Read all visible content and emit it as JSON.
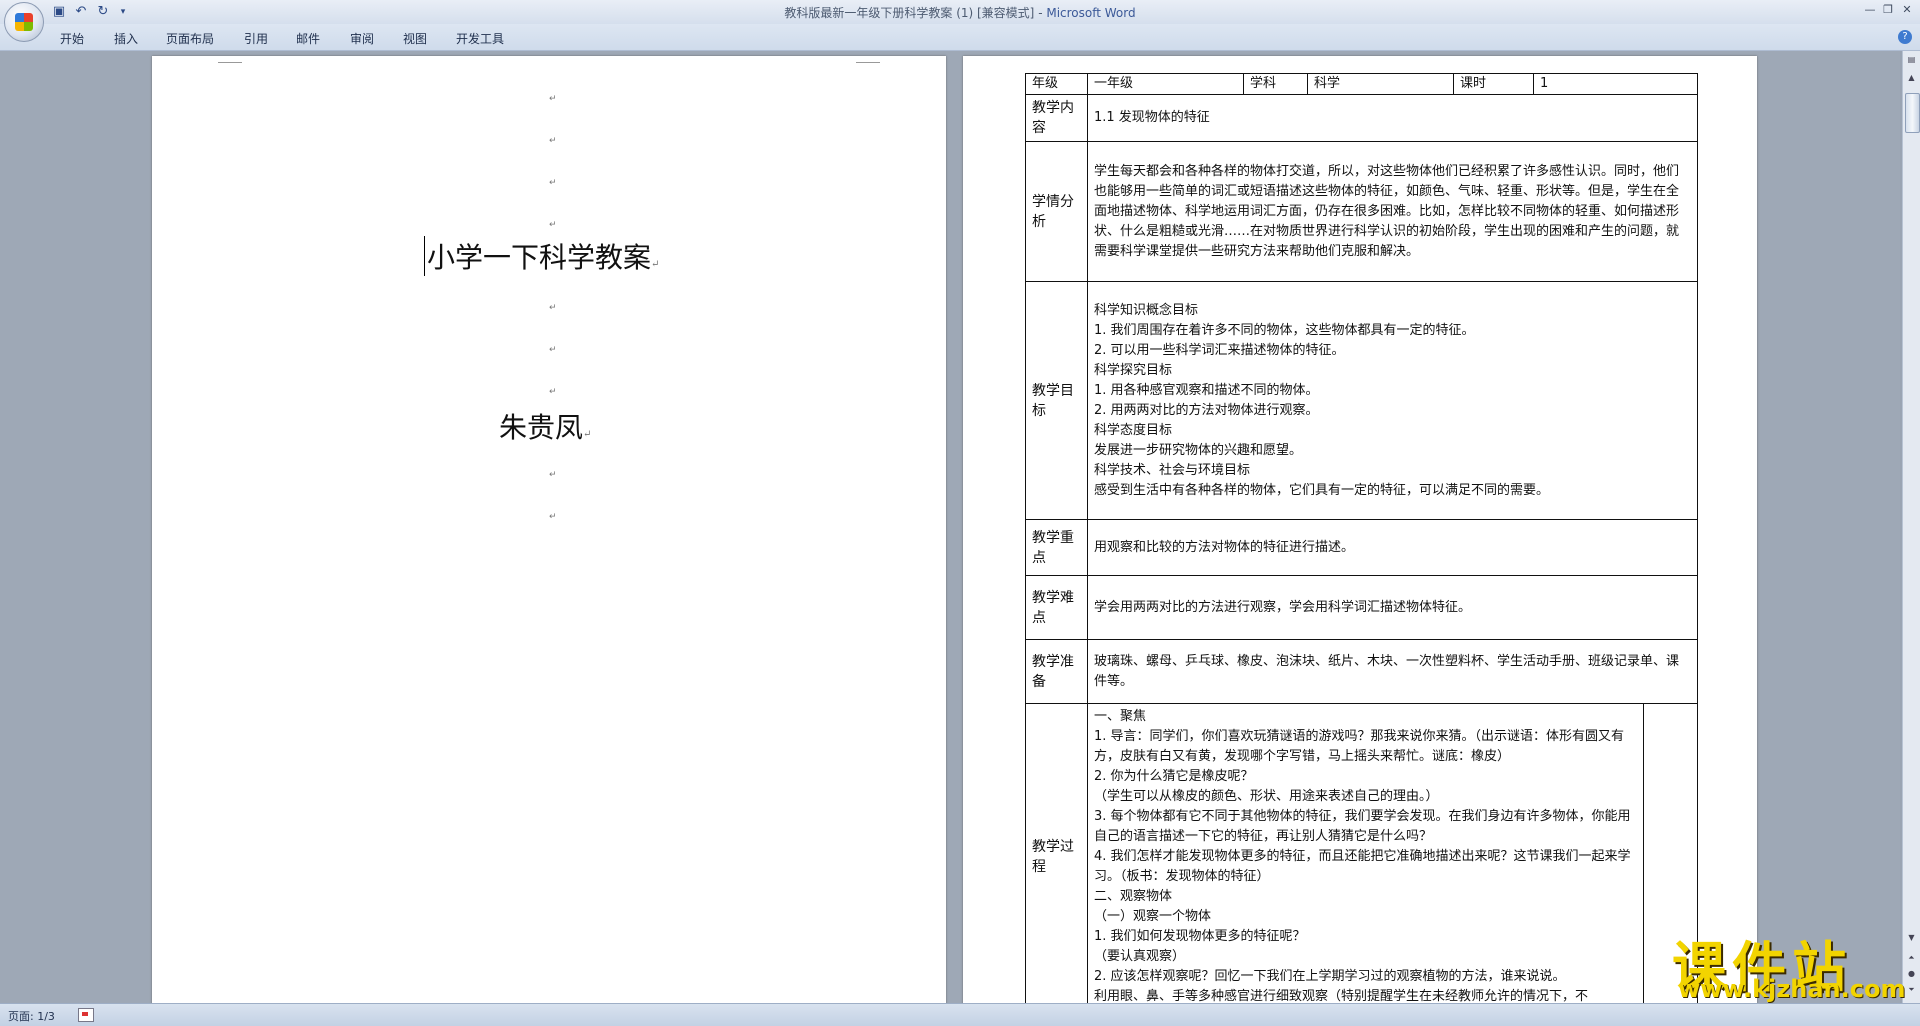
{
  "window": {
    "title": "教科版最新一年级下册科学教案 (1) [兼容模式]",
    "app_name": "Microsoft Word",
    "title_separator": " - "
  },
  "quick_access": {
    "save_icon": "save-icon",
    "undo_icon": "undo-icon",
    "redo_icon": "redo-icon",
    "customize_icon": "dropdown-icon"
  },
  "ribbon": {
    "tabs": [
      "开始",
      "插入",
      "页面布局",
      "引用",
      "邮件",
      "审阅",
      "视图",
      "开发工具"
    ]
  },
  "page1": {
    "title": "小学一下科学教案",
    "author": "朱贵凤",
    "para_mark": "↵"
  },
  "lesson": {
    "header": {
      "grade_label": "年级",
      "grade_value": "一年级",
      "subject_label": "学科",
      "subject_value": "科学",
      "period_label": "课时",
      "period_value": "1"
    },
    "rows": [
      {
        "label": "教学内容",
        "text": "1.1 发现物体的特征"
      },
      {
        "label": "学情分析",
        "text": "学生每天都会和各种各样的物体打交道，所以，对这些物体他们已经积累了许多感性认识。同时，他们也能够用一些简单的词汇或短语描述这些物体的特征，如颜色、气味、轻重、形状等。但是，学生在全面地描述物体、科学地运用词汇方面，仍存在很多困难。比如，怎样比较不同物体的轻重、如何描述形状、什么是粗糙或光滑……在对物质世界进行科学认识的初始阶段，学生出现的困难和产生的问题，就需要科学课堂提供一些研究方法来帮助他们克服和解决。"
      },
      {
        "label": "教学目标",
        "lines": [
          "科学知识概念目标",
          "1. 我们周围存在着许多不同的物体，这些物体都具有一定的特征。",
          "2. 可以用一些科学词汇来描述物体的特征。",
          "科学探究目标",
          "1. 用各种感官观察和描述不同的物体。",
          "2. 用两两对比的方法对物体进行观察。",
          "科学态度目标",
          "发展进一步研究物体的兴趣和愿望。",
          "科学技术、社会与环境目标",
          "感受到生活中有各种各样的物体，它们具有一定的特征，可以满足不同的需要。"
        ]
      },
      {
        "label": "教学重点",
        "text": "用观察和比较的方法对物体的特征进行描述。"
      },
      {
        "label": "教学难点",
        "text": "学会用两两对比的方法进行观察，学会用科学词汇描述物体特征。"
      },
      {
        "label": "教学准备",
        "text": "玻璃珠、螺母、乒乓球、橡皮、泡沫块、纸片、木块、一次性塑料杯、学生活动手册、班级记录单、课件等。"
      },
      {
        "label": "教学过程",
        "lines": [
          "一、聚焦",
          "1. 导言：同学们，你们喜欢玩猜谜语的游戏吗？那我来说你来猜。（出示谜语：体形有圆又有方，皮肤有白又有黄，发现哪个字写错，马上摇头来帮忙。谜底：橡皮）",
          "2. 你为什么猜它是橡皮呢？",
          "（学生可以从橡皮的颜色、形状、用途来表述自己的理由。）",
          "3. 每个物体都有它不同于其他物体的特征，我们要学会发现。在我们身边有许多物体，你能用自己的语言描述一下它的特征，再让别人猜猜它是什么吗？",
          "4. 我们怎样才能发现物体更多的特征，而且还能把它准确地描述出来呢？这节课我们一起来学习。（板书：发现物体的特征）",
          "二、观察物体",
          "（一）观察一个物体",
          "1. 我们如何发现物体更多的特征呢？",
          "（要认真观察）",
          "2. 应该怎样观察呢？回忆一下我们在上学期学习过的观察植物的方法，谁来说说。",
          "利用眼、鼻、手等多种感官进行细致观察（特别提醒学生在未经教师允许的情况下，不"
        ]
      }
    ]
  },
  "status": {
    "page_info": "页面: 1/3"
  },
  "watermark": {
    "title": "课件站",
    "url": "www.kjzhan.com"
  },
  "colors": {
    "ribbon_bg": "#dde6f2",
    "workspace_bg": "#9ea8b6",
    "watermark": "#f2d400"
  }
}
